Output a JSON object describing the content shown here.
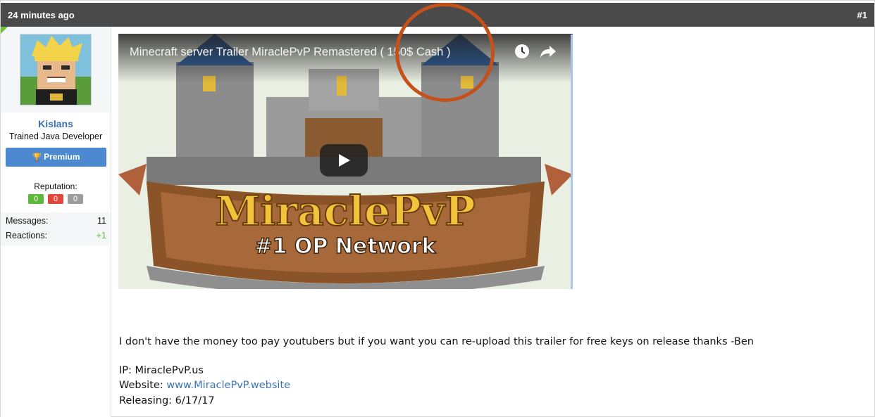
{
  "header": {
    "time_ago": "24 minutes ago",
    "post_number": "#1"
  },
  "user": {
    "name": "Kislans",
    "title": "Trained Java Developer",
    "premium_label": "Premium",
    "reputation_label": "Reputation:",
    "reputation": {
      "positive": "0",
      "negative": "0",
      "neutral": "0"
    },
    "stats": [
      {
        "label": "Messages:",
        "value": "11"
      },
      {
        "label": "Reactions:",
        "value": "+1"
      }
    ]
  },
  "video": {
    "title": "Minecraft server Trailer MiraclePvP Remastered ( 150$ Cash )",
    "logo_line1": "MiraclePvP",
    "logo_line2": "#1 OP Network"
  },
  "post": {
    "message": "I don't have the money too pay youtubers but if you want you can re-upload this trailer for free keys on release thanks -Ben",
    "ip_label": "IP: ",
    "ip_value": "MiraclePvP.us",
    "website_label": "Website: ",
    "website_link": "www.MiraclePvP.website",
    "release_label": "Releasing: ",
    "release_date": "6/17/17"
  },
  "colors": {
    "header_bg": "#4a4a4a",
    "link": "#3b72b5",
    "premium": "#4c89d0",
    "highlight": "#c4501a"
  }
}
